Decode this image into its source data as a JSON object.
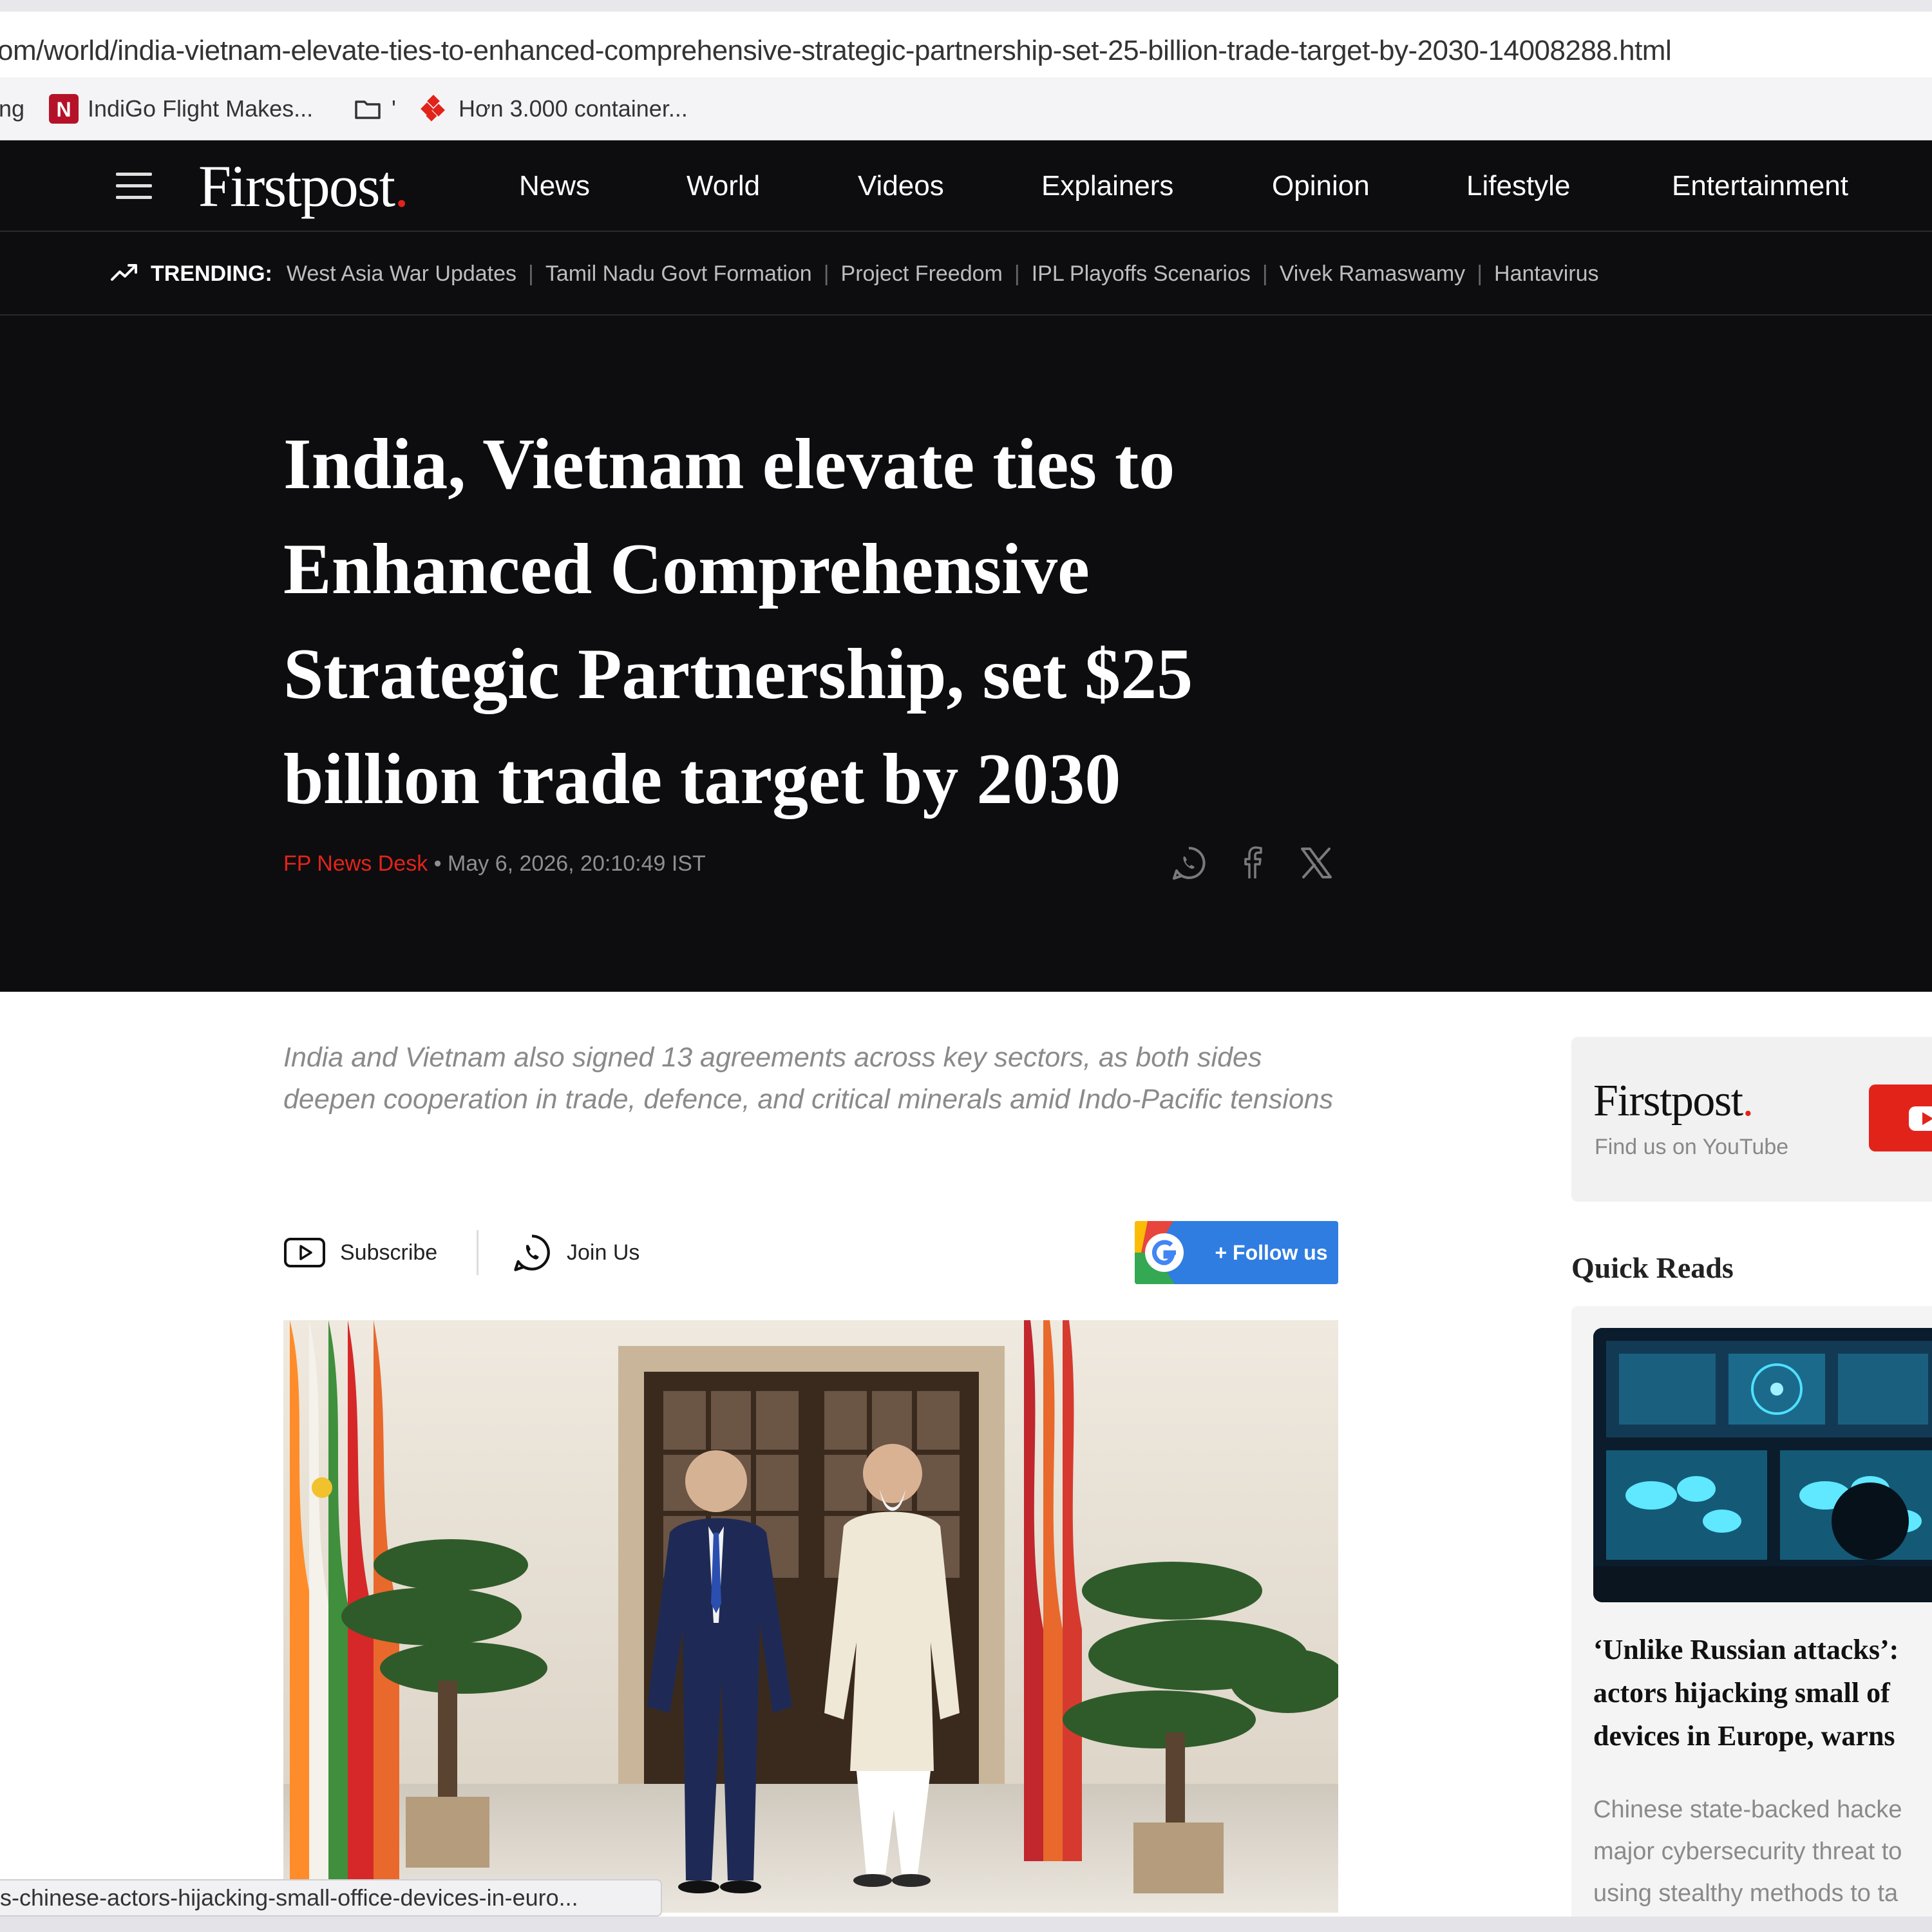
{
  "browser": {
    "url": "om/world/india-vietnam-elevate-ties-to-enhanced-comprehensive-strategic-partnership-set-25-billion-trade-target-by-2030-14008288.html",
    "bookmarks": [
      {
        "label": "ng",
        "icon": "none"
      },
      {
        "label": "IndiGo Flight Makes...",
        "icon": "n-logo-icon"
      },
      {
        "label": "'",
        "icon": "folder-icon"
      },
      {
        "label": "Hơn 3.000 container...",
        "icon": "diamond-logo-icon"
      }
    ],
    "status_url": "s-chinese-actors-hijacking-small-office-devices-in-euro..."
  },
  "site": {
    "logo_text": "Firstpost",
    "logo_dot": ".",
    "nav": [
      "News",
      "World",
      "Videos",
      "Explainers",
      "Opinion",
      "Lifestyle",
      "Entertainment"
    ],
    "trending_label": "TRENDING:",
    "trending": [
      "West Asia War Updates",
      "Tamil Nadu Govt Formation",
      "Project Freedom",
      "IPL Playoffs Scenarios",
      "Vivek Ramaswamy",
      "Hantavirus"
    ]
  },
  "article": {
    "headline": "India, Vietnam elevate ties to Enhanced Comprehensive Strategic Partnership, set $25 billion trade target by 2030",
    "author": "FP News Desk",
    "separator": "•",
    "date": "May 6, 2026, 20:10:49 IST",
    "share_icons": [
      "whatsapp-icon",
      "facebook-icon",
      "x-icon"
    ],
    "dek": "India and Vietnam also signed 13 agreements across key sectors, as both sides deepen cooperation in trade, defence, and critical minerals amid Indo-Pacific tensions",
    "subscribe_label": "Subscribe",
    "join_label": "Join Us",
    "follow_label": "+ Follow us"
  },
  "sidebar": {
    "yt_logo": "Firstpost",
    "yt_sub": "Find us on YouTube",
    "quick_reads_title": "Quick Reads",
    "quick_read": {
      "headline_lines": [
        "‘Unlike Russian attacks’:",
        "actors hijacking small of",
        "devices in Europe, warns"
      ],
      "text_lines": [
        "Chinese state-backed hacke",
        "major cybersecurity threat to",
        "using stealthy methods to ta"
      ]
    }
  },
  "colors": {
    "brand_red": "#e2231a",
    "header_bg": "#0d0d0f",
    "follow_blue": "#2f7de1"
  }
}
